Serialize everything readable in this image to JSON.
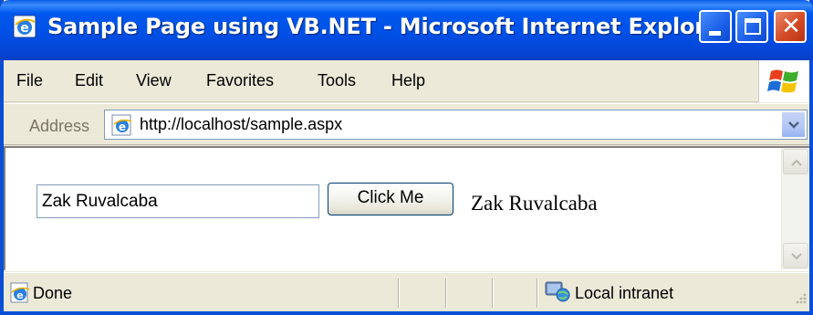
{
  "window": {
    "title": "Sample Page using VB.NET - Microsoft Internet Explorer",
    "title_bar_color": "#0054e3",
    "close_button_color": "#d44a26"
  },
  "menu": {
    "items": [
      {
        "label": "File"
      },
      {
        "label": "Edit"
      },
      {
        "label": "View"
      },
      {
        "label": "Favorites"
      },
      {
        "label": "Tools"
      },
      {
        "label": "Help"
      }
    ],
    "logo_icon": "windows-flag-icon"
  },
  "address": {
    "label": "Address",
    "url": "http://localhost/sample.aspx",
    "page_icon": "ie-page-icon"
  },
  "page": {
    "input_value": "Zak Ruvalcaba",
    "button_label": "Click Me",
    "output_text": "Zak Ruvalcaba"
  },
  "status": {
    "text": "Done",
    "zone": "Local intranet",
    "zone_icon": "local-intranet-icon"
  }
}
